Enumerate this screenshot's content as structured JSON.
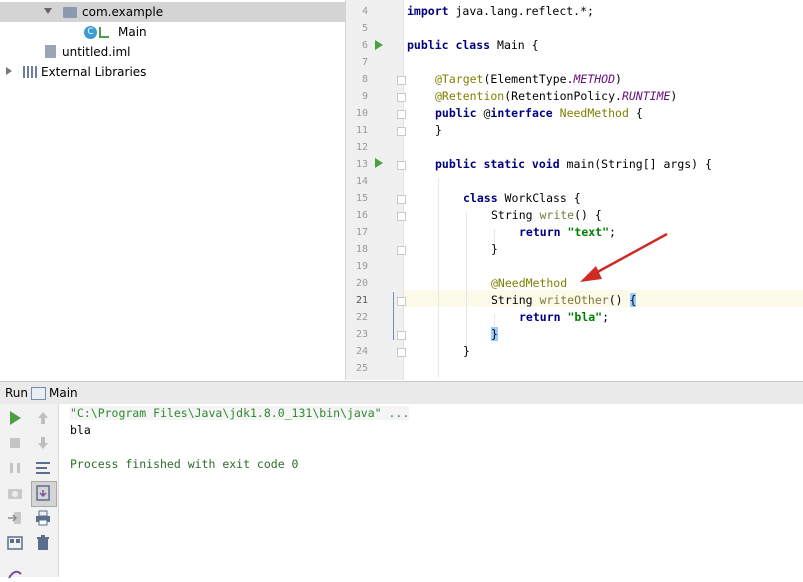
{
  "project_tree": {
    "items": [
      {
        "label": "com.example",
        "icon": "package-icon"
      },
      {
        "label": "Main",
        "icon": "class-icon"
      },
      {
        "label": "untitled.iml",
        "icon": "iml-file-icon"
      },
      {
        "label": "External Libraries",
        "icon": "library-icon"
      }
    ]
  },
  "editor": {
    "line_numbers": [
      "4",
      "5",
      "6",
      "7",
      "8",
      "9",
      "10",
      "11",
      "12",
      "13",
      "14",
      "15",
      "16",
      "17",
      "18",
      "19",
      "20",
      "21",
      "22",
      "23",
      "24",
      "25"
    ],
    "current_line": "21"
  },
  "run_panel": {
    "tab_label": "Run",
    "config_name": "Main",
    "console": {
      "command": "\"C:\\Program Files\\Java\\jdk1.8.0_131\\bin\\java\" ...",
      "output": "bla",
      "exit_message": "Process finished with exit code 0"
    }
  },
  "colors": {
    "keyword": "#000080",
    "annotation": "#808000",
    "string": "#008000",
    "constant": "#660e7a",
    "arrow": "#d02a24",
    "run_green": "#4d9f45"
  }
}
